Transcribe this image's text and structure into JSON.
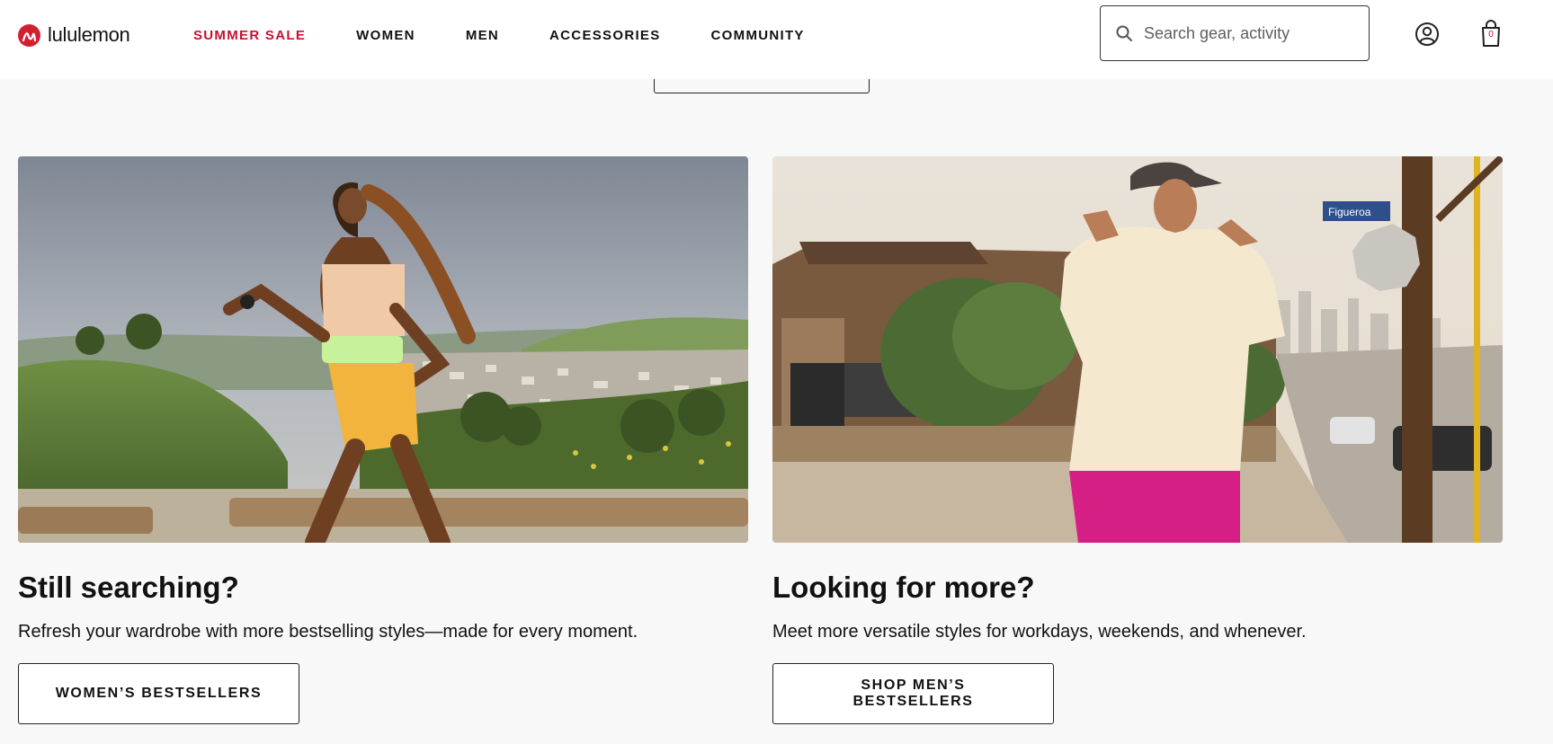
{
  "brand": {
    "name": "lululemon",
    "accent": "#c8102e"
  },
  "nav": {
    "items": [
      "SUMMER SALE",
      "WOMEN",
      "MEN",
      "ACCESSORIES",
      "COMMUNITY"
    ]
  },
  "search": {
    "placeholder": "Search gear, activity"
  },
  "cart": {
    "count": "0"
  },
  "promos": [
    {
      "title": "Still searching?",
      "description": "Refresh your wardrobe with more bestselling styles—made for every moment.",
      "button": "WOMEN’S BESTSELLERS",
      "image": "woman running on hillside trail"
    },
    {
      "title": "Looking for more?",
      "description": "Meet more versatile styles for workdays, weekends, and whenever.",
      "button": "SHOP MEN’S BESTSELLERS",
      "image": "man in cream hoodie on city street",
      "sign": "Figueroa"
    }
  ]
}
